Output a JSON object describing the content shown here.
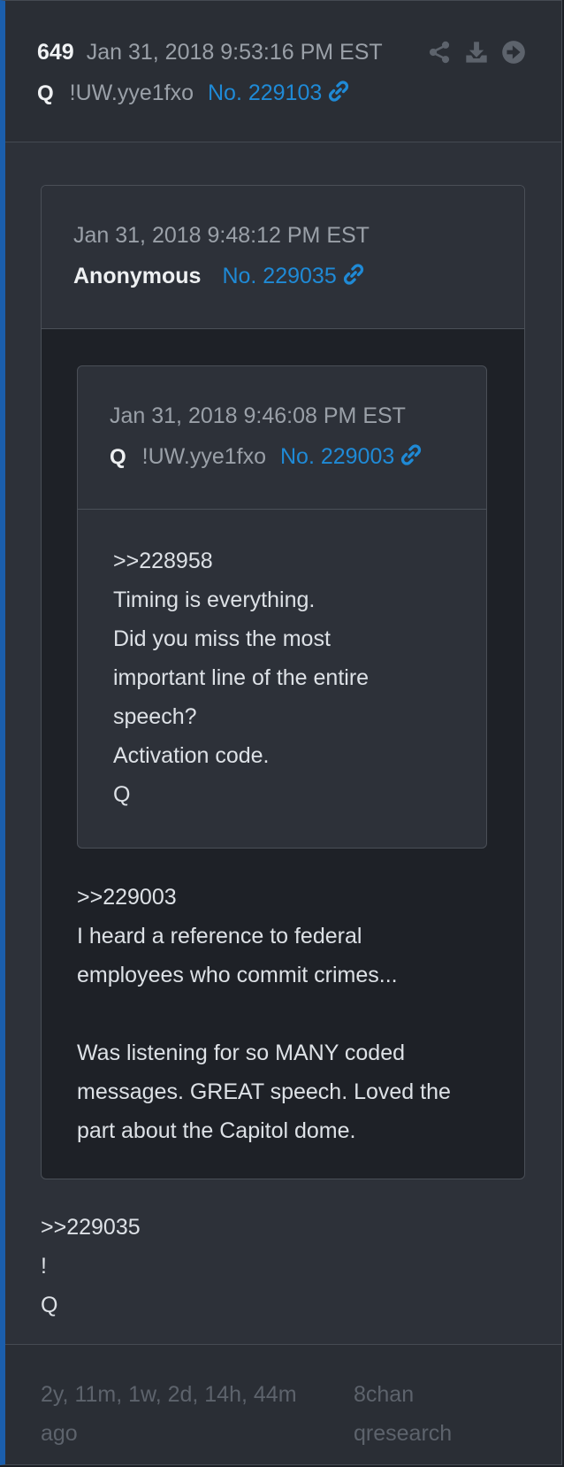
{
  "post": {
    "number": "649",
    "timestamp": "Jan 31, 2018 9:53:16 PM EST",
    "author": "Q",
    "tripcode": "!UW.yye1fxo",
    "link": "No. 229103",
    "actions": [
      "share-icon",
      "download-icon",
      "arrow-right-circle-icon"
    ],
    "body": [
      ">>229035",
      "!",
      "Q"
    ]
  },
  "quote1": {
    "timestamp": "Jan 31, 2018 9:48:12 PM EST",
    "author": "Anonymous",
    "link": "No. 229035",
    "body": [
      ">>229003",
      "I heard a reference to federal",
      "employees who commit crimes...",
      "",
      "Was listening for so MANY coded",
      "messages.  GREAT speech.  Loved the",
      "part about the Capitol dome."
    ]
  },
  "quote2": {
    "timestamp": "Jan 31, 2018 9:46:08 PM EST",
    "author": "Q",
    "tripcode": "!UW.yye1fxo",
    "link": "No. 229003",
    "body": [
      ">>228958",
      "Timing is everything.",
      "Did you miss the most",
      "important line of the entire",
      "speech?",
      "Activation code.",
      "Q"
    ]
  },
  "footer": {
    "ago_lines": [
      "2y, 11m, 1w, 2d, 14h, 44m",
      "ago"
    ],
    "source_lines": [
      "8chan",
      "qresearch"
    ]
  },
  "colors": {
    "accent_bar": "#1b5eac",
    "link": "#1f8ad6",
    "card_bg": "#2d3139",
    "inner_bg": "#1e2127"
  }
}
